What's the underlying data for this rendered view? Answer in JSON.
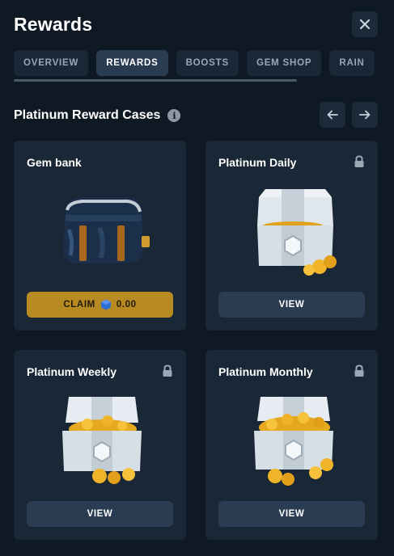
{
  "title": "Rewards",
  "tabs": [
    {
      "label": "OVERVIEW",
      "active": false
    },
    {
      "label": "REWARDS",
      "active": true
    },
    {
      "label": "BOOSTS",
      "active": false
    },
    {
      "label": "GEM SHOP",
      "active": false
    },
    {
      "label": "RAIN",
      "active": false
    }
  ],
  "section": {
    "title": "Platinum Reward Cases"
  },
  "cards": [
    {
      "title": "Gem bank",
      "locked": false,
      "button": {
        "label": "CLAIM",
        "value": "0.00",
        "type": "claim"
      }
    },
    {
      "title": "Platinum Daily",
      "locked": true,
      "button": {
        "label": "VIEW",
        "type": "view"
      }
    },
    {
      "title": "Platinum Weekly",
      "locked": true,
      "button": {
        "label": "VIEW",
        "type": "view"
      }
    },
    {
      "title": "Platinum Monthly",
      "locked": true,
      "button": {
        "label": "VIEW",
        "type": "view"
      }
    }
  ],
  "colors": {
    "background": "#0f1923",
    "card": "#1a2737",
    "tab_active": "#2a3c52",
    "claim_button": "#b88a22",
    "gem": "#2f6fd6"
  },
  "icons": {
    "close": "close-icon",
    "info": "info-icon",
    "prev": "arrow-left-icon",
    "next": "arrow-right-icon",
    "lock": "lock-icon",
    "gem": "gem-icon"
  }
}
